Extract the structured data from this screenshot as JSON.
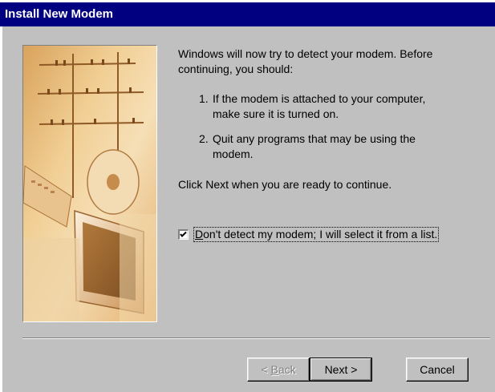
{
  "window": {
    "title": "Install New Modem"
  },
  "wizard_image": {
    "icon": "modem-illustration-icon",
    "colors": {
      "sand": "#e8b877",
      "light": "#f5e2bd",
      "dark": "#a87440",
      "border": "#e8c08a"
    }
  },
  "content": {
    "intro": "Windows will now try to detect your modem.  Before continuing, you should:",
    "steps": [
      {
        "num": "1.",
        "text": "If the modem is attached to your computer, make sure it is turned on."
      },
      {
        "num": "2.",
        "text": "Quit any programs that may be using the modem."
      }
    ],
    "click_next": "Click Next when you are ready to continue."
  },
  "checkbox": {
    "checked": true,
    "label_underlined": "D",
    "label_rest": "on't detect my modem; I will select it from a list."
  },
  "buttons": {
    "back_prefix": "< ",
    "back_underlined": "B",
    "back_rest": "ack",
    "next": "Next >",
    "cancel": "Cancel"
  },
  "colors": {
    "title_bar": "#000080",
    "face": "#c0c0c0"
  }
}
